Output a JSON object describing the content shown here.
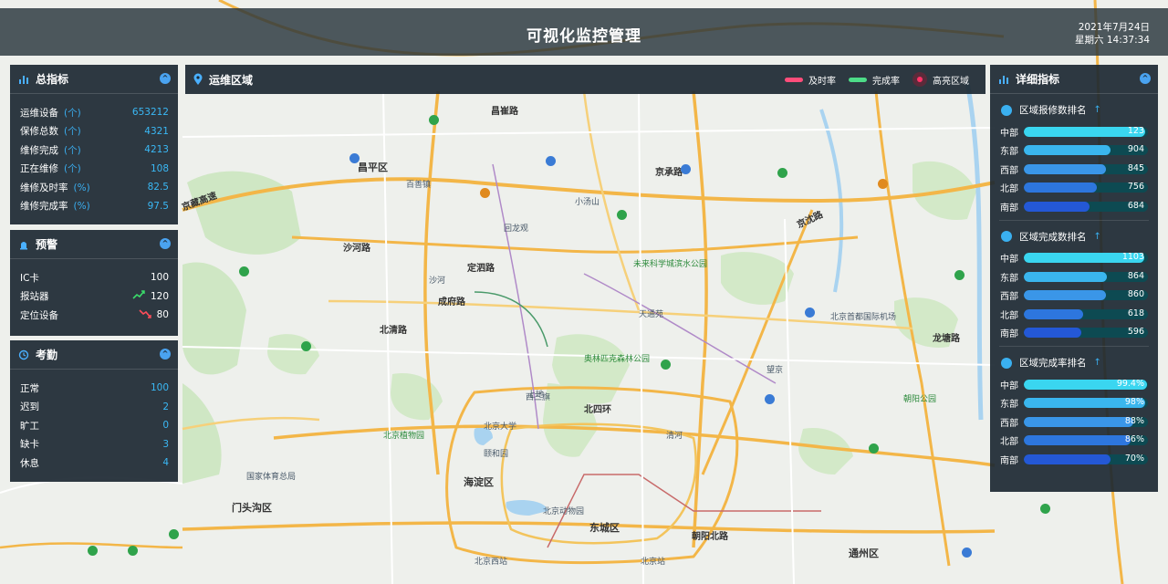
{
  "header": {
    "title": "可视化监控管理",
    "date": "2021年7月24日",
    "time": "星期六 14:37:34"
  },
  "colors": {
    "panel_bg": "#1c2832",
    "accent_blue": "#3ab8f5",
    "timely_rate": "#ff4d7a",
    "completion_rate": "#4ddc88",
    "alarm_area": "#ff3366"
  },
  "summary": {
    "title": "总指标",
    "icon": "bar-chart-icon",
    "items": [
      {
        "label": "运维设备",
        "unit": "(个)",
        "value": "653212"
      },
      {
        "label": "保修总数",
        "unit": "(个)",
        "value": "4321"
      },
      {
        "label": "维修完成",
        "unit": "(个)",
        "value": "4213"
      },
      {
        "label": "正在维修",
        "unit": "(个)",
        "value": "108"
      },
      {
        "label": "维修及时率",
        "unit": "(%)",
        "value": "82.5"
      },
      {
        "label": "维修完成率",
        "unit": "(%)",
        "value": "97.5"
      }
    ]
  },
  "warning": {
    "title": "预警",
    "icon": "alarm-icon",
    "items": [
      {
        "label": "IC卡",
        "trend": "",
        "value": "100"
      },
      {
        "label": "报站器",
        "trend": "up",
        "value": "120"
      },
      {
        "label": "定位设备",
        "trend": "down",
        "value": "80"
      }
    ]
  },
  "attendance": {
    "title": "考勤",
    "icon": "clock-icon",
    "items": [
      {
        "label": "正常",
        "value": "100"
      },
      {
        "label": "迟到",
        "value": "2"
      },
      {
        "label": "旷工",
        "value": "0"
      },
      {
        "label": "缺卡",
        "value": "3"
      },
      {
        "label": "休息",
        "value": "4"
      }
    ]
  },
  "ops_area": {
    "title": "运维区域",
    "legend": [
      {
        "label": "及时率",
        "color": "#ff4d7a"
      },
      {
        "label": "完成率",
        "color": "#4ddc88"
      },
      {
        "label": "高亮区域",
        "color": "#ff3366"
      }
    ]
  },
  "detail": {
    "title": "详细指标",
    "sections": [
      {
        "title": "区域报修数排名",
        "arrow": "↑",
        "rows": [
          {
            "label": "中部",
            "value": "123",
            "fraction": 0.98,
            "color": "#3ad6f0"
          },
          {
            "label": "东部",
            "value": "904",
            "fraction": 0.7,
            "color": "#3ab6ee"
          },
          {
            "label": "西部",
            "value": "845",
            "fraction": 0.66,
            "color": "#3a96e8"
          },
          {
            "label": "北部",
            "value": "756",
            "fraction": 0.59,
            "color": "#2d76de"
          },
          {
            "label": "南部",
            "value": "684",
            "fraction": 0.53,
            "color": "#2458d6"
          }
        ]
      },
      {
        "title": "区域完成数排名",
        "arrow": "↑",
        "rows": [
          {
            "label": "中部",
            "value": "1103",
            "fraction": 0.97,
            "color": "#3ad6f0"
          },
          {
            "label": "东部",
            "value": "864",
            "fraction": 0.67,
            "color": "#3ab6ee"
          },
          {
            "label": "西部",
            "value": "860",
            "fraction": 0.66,
            "color": "#3a96e8"
          },
          {
            "label": "北部",
            "value": "618",
            "fraction": 0.48,
            "color": "#2d76de"
          },
          {
            "label": "南部",
            "value": "596",
            "fraction": 0.46,
            "color": "#2458d6"
          }
        ]
      },
      {
        "title": "区域完成率排名",
        "arrow": "↑",
        "rows": [
          {
            "label": "中部",
            "value": "99.4%",
            "fraction": 0.994,
            "color": "#3ad6f0"
          },
          {
            "label": "东部",
            "value": "98%",
            "fraction": 0.98,
            "color": "#3ab6ee"
          },
          {
            "label": "西部",
            "value": "88%",
            "fraction": 0.88,
            "color": "#3a96e8"
          },
          {
            "label": "北部",
            "value": "86%",
            "fraction": 0.86,
            "color": "#2d76de"
          },
          {
            "label": "南部",
            "value": "70%",
            "fraction": 0.7,
            "color": "#2458d6"
          }
        ]
      }
    ]
  },
  "map_labels": {
    "roads": [
      "京藏高速",
      "北清路",
      "定泗路",
      "昌崔路",
      "沙河路",
      "京承路",
      "京沈路",
      "北四环",
      "成府路",
      "龙塘路",
      "朝阳北路"
    ],
    "places": [
      "昌平区",
      "北京大学",
      "颐和园",
      "海淀区",
      "门头沟区",
      "东城区",
      "通州区",
      "清河",
      "西三旗",
      "回龙观",
      "天通苑",
      "望京",
      "朝阳公园",
      "北京站",
      "北京西站",
      "未来科学城滨水公园",
      "奥林匹克森林公园",
      "北京植物园",
      "沙河",
      "小汤山",
      "百善镇",
      "上地",
      "北京动物园",
      "国家体育总局",
      "北京首都国际机场"
    ]
  }
}
